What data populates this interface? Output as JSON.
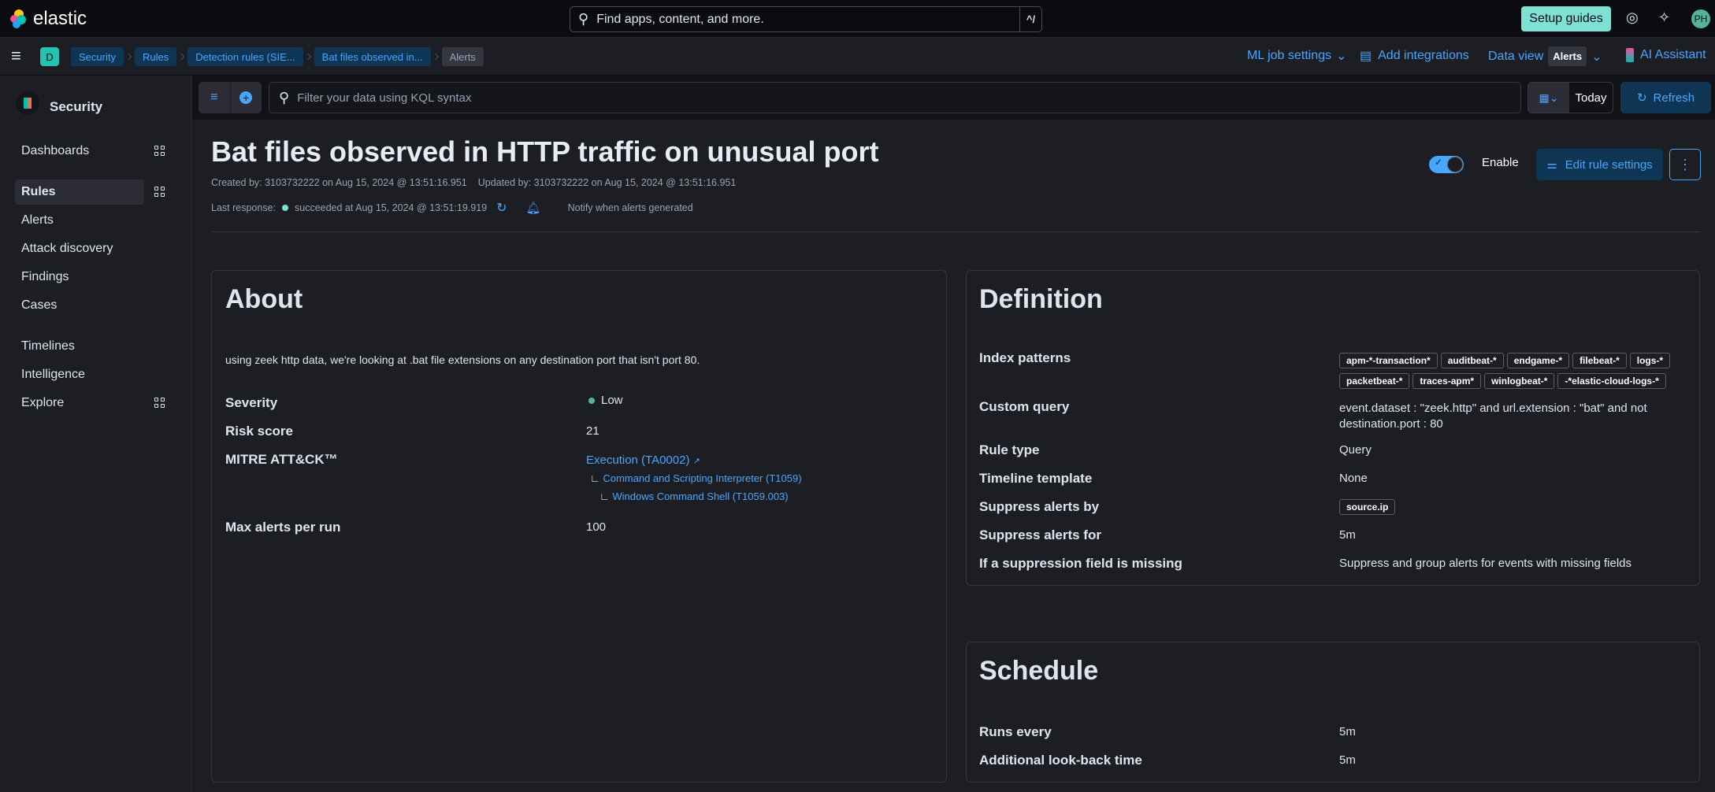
{
  "header": {
    "brand": "elastic",
    "search_placeholder": "Find apps, content, and more.",
    "search_shortcut": "^/",
    "setup_guides": "Setup guides",
    "avatar_initials": "PH"
  },
  "subbar": {
    "space_badge": "D",
    "breadcrumbs": [
      "Security",
      "Rules",
      "Detection rules (SIE...",
      "Bat files observed in...",
      "Alerts"
    ],
    "ml_job_settings": "ML job settings",
    "add_integrations": "Add integrations",
    "data_view_label": "Data view",
    "data_view_value": "Alerts",
    "ai_assistant": "AI Assistant"
  },
  "sidebar": {
    "title": "Security",
    "items": [
      {
        "label": "Dashboards"
      },
      {
        "label": "Rules",
        "active": true
      },
      {
        "label": "Alerts"
      },
      {
        "label": "Attack discovery"
      },
      {
        "label": "Findings"
      },
      {
        "label": "Cases"
      },
      {
        "label": "Timelines"
      },
      {
        "label": "Intelligence"
      },
      {
        "label": "Explore"
      }
    ]
  },
  "filterbar": {
    "kql_placeholder": "Filter your data using KQL syntax",
    "date": "Today",
    "refresh": "Refresh"
  },
  "rule": {
    "title": "Bat files observed in HTTP traffic on unusual port",
    "created": "Created by: 3103732222 on Aug 15, 2024 @ 13:51:16.951",
    "updated": "Updated by: 3103732222 on Aug 15, 2024 @ 13:51:16.951",
    "last_response_label": "Last response:",
    "last_response": "succeeded at Aug 15, 2024 @ 13:51:19.919",
    "notify": "Notify when alerts generated",
    "enable_label": "Enable",
    "enabled": true,
    "edit_settings": "Edit rule settings"
  },
  "about": {
    "heading": "About",
    "description": "using zeek http data, we're looking at .bat file extensions on any destination port that isn't port 80.",
    "severity_label": "Severity",
    "severity": "Low",
    "severity_color": "#54b399",
    "risk_label": "Risk score",
    "risk": "21",
    "mitre_label": "MITRE ATT&CK™",
    "tactic": "Execution (TA0002)",
    "technique": "Command and Scripting Interpreter (T1059)",
    "subtechnique": "Windows Command Shell (T1059.003)",
    "max_alerts_label": "Max alerts per run",
    "max_alerts": "100"
  },
  "definition": {
    "heading": "Definition",
    "index_label": "Index patterns",
    "index_patterns": [
      "apm-*-transaction*",
      "auditbeat-*",
      "endgame-*",
      "filebeat-*",
      "logs-*",
      "packetbeat-*",
      "traces-apm*",
      "winlogbeat-*",
      "-*elastic-cloud-logs-*"
    ],
    "query_label": "Custom query",
    "query": "event.dataset : \"zeek.http\" and url.extension : \"bat\" and not destination.port : 80",
    "rule_type_label": "Rule type",
    "rule_type": "Query",
    "timeline_label": "Timeline template",
    "timeline": "None",
    "suppress_by_label": "Suppress alerts by",
    "suppress_by": "source.ip",
    "suppress_for_label": "Suppress alerts for",
    "suppress_for": "5m",
    "missing_label": "If a suppression field is missing",
    "missing": "Suppress and group alerts for events with missing fields"
  },
  "schedule": {
    "heading": "Schedule",
    "runs_label": "Runs every",
    "runs": "5m",
    "lookback_label": "Additional look-back time",
    "lookback": "5m"
  }
}
